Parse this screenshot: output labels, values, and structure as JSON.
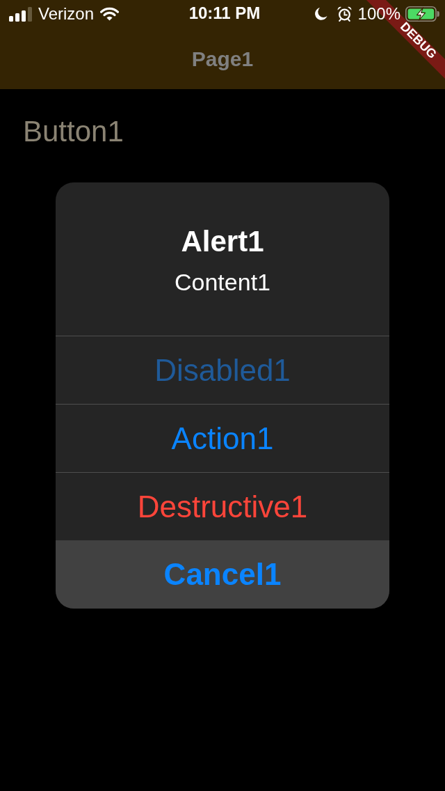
{
  "status_bar": {
    "carrier": "Verizon",
    "time": "10:11 PM",
    "battery": "100%"
  },
  "debug_banner": {
    "label": "DEBUG"
  },
  "navigation_bar": {
    "title": "Page1"
  },
  "page": {
    "button": "Button1"
  },
  "alert": {
    "title": "Alert1",
    "content": "Content1",
    "actions": [
      {
        "label": "Disabled1",
        "kind": "action",
        "disabled": true
      },
      {
        "label": "Action1",
        "kind": "action",
        "disabled": false
      },
      {
        "label": "Destructive1",
        "kind": "destructive",
        "disabled": false
      },
      {
        "label": "Cancel1",
        "kind": "cancel",
        "disabled": false
      }
    ]
  }
}
